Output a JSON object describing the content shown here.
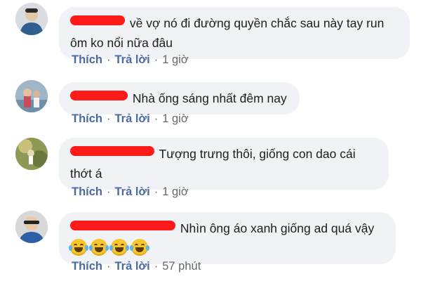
{
  "comments": [
    {
      "text": "về vợ nó đi đường quyền chắc sau này tay run ôm ko nổi nữa đâu",
      "like_label": "Thích",
      "reply_label": "Trả lời",
      "time": "1 giờ",
      "avatar_colors": [
        "#2e5f8f",
        "#e4c7a6"
      ]
    },
    {
      "text": "Nhà ống sáng nhất đêm nay",
      "like_label": "Thích",
      "reply_label": "Trả lời",
      "time": "1 giờ",
      "avatar_colors": [
        "#6f8fa9",
        "#c84b5a"
      ]
    },
    {
      "text": "Tượng trưng thôi, giống con dao cái thớt á",
      "like_label": "Thích",
      "reply_label": "Trả lời",
      "time": "1 giờ",
      "avatar_colors": [
        "#6a7a3c",
        "#c9c07a"
      ]
    },
    {
      "text": "Nhìn ông áo xanh giống ad quá vậy",
      "like_label": "Thích",
      "reply_label": "Trả lời",
      "time": "57 phút",
      "emoji": [
        "laughing-tears-emoji",
        "laughing-tears-emoji",
        "laughing-tears-emoji",
        "laughing-tears-emoji"
      ],
      "avatar_colors": [
        "#d8d8d8",
        "#2b5fa8"
      ]
    }
  ],
  "separator": "·",
  "colors": {
    "bubble": "#f0f2f5",
    "action_link": "#4b6aa1",
    "redaction": "#ff1a1a"
  }
}
